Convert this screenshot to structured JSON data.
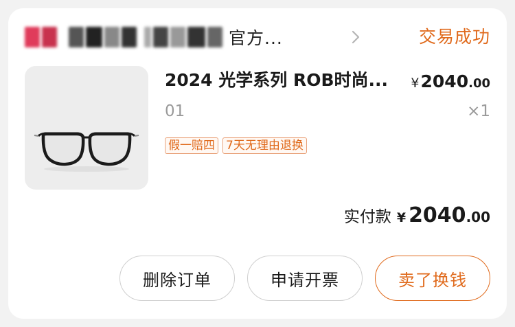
{
  "store": {
    "name_visible_suffix": "官方...",
    "status": "交易成功"
  },
  "product": {
    "title": "2024 光学系列 ROB时尚...",
    "price_currency": "¥",
    "price_int": "2040",
    "price_dec": ".00",
    "variant": "01",
    "quantity": "×1",
    "tags": [
      "假一赔四",
      "7天无理由退换"
    ]
  },
  "total": {
    "label": "实付款",
    "currency": "¥",
    "int": "2040",
    "dec": ".00"
  },
  "actions": {
    "delete_label": "删除订单",
    "invoice_label": "申请开票",
    "sell_label": "卖了换钱"
  },
  "colors": {
    "accent": "#e06a1c",
    "tag_border": "#e9a27a"
  }
}
